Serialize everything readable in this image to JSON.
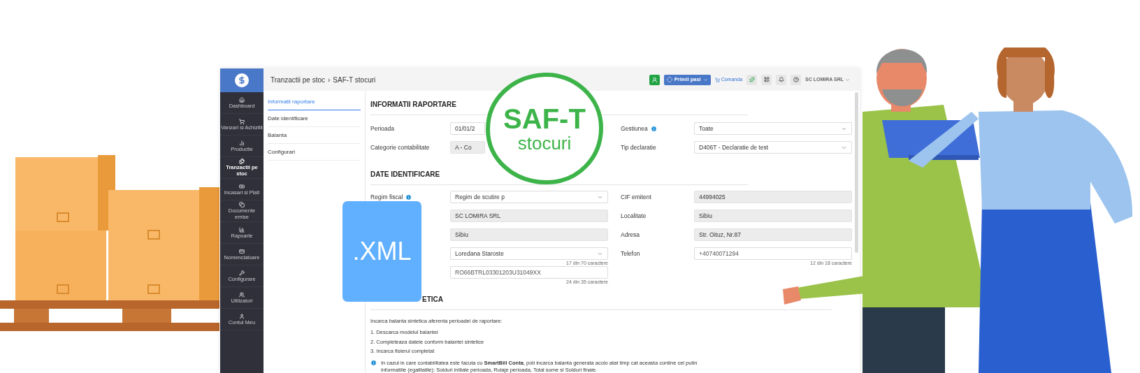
{
  "sidebar": {
    "items": [
      {
        "label": "Dashboard",
        "selected": false
      },
      {
        "label": "Vanzari si Achizitii",
        "selected": false
      },
      {
        "label": "Productie",
        "selected": false
      },
      {
        "label": "Tranzactii pe stoc",
        "selected": true
      },
      {
        "label": "Incasari si Plati",
        "selected": false
      },
      {
        "label": "Documente emise",
        "selected": false
      },
      {
        "label": "Rapoarte",
        "selected": false
      },
      {
        "label": "Nomenclatoare",
        "selected": false
      },
      {
        "label": "Configurare",
        "selected": false
      },
      {
        "label": "Utilizatori",
        "selected": false
      },
      {
        "label": "Contul Meu",
        "selected": false
      }
    ]
  },
  "breadcrumb": {
    "items": [
      "Tranzactii pe stoc",
      "SAF-T stocuri"
    ],
    "separator": "›"
  },
  "toolbar": {
    "primary_button": "Primii pasi",
    "order_link": "Comanda",
    "company": "SC LOMIRA SRL"
  },
  "subnav": [
    {
      "label": "Informatii raportare",
      "selected": true
    },
    {
      "label": "Date identificare",
      "selected": false
    },
    {
      "label": "Balanta",
      "selected": false
    },
    {
      "label": "Configurari",
      "selected": false
    }
  ],
  "sections": [
    {
      "heading": "INFORMATII RAPORTARE",
      "rows": [
        {
          "left": {
            "label": "Perioada",
            "kind": "date",
            "value": "01/01/2"
          },
          "right": {
            "label": "Gestiunea",
            "info": true,
            "kind": "select",
            "value": "Toate"
          }
        },
        {
          "left": {
            "label": "Categorie contabilitate",
            "kind": "locked_select",
            "value": "A - Co"
          },
          "right": {
            "label": "Tip declaratie",
            "kind": "select",
            "value": "D406T - Declaratie de test"
          }
        }
      ]
    },
    {
      "heading": "DATE IDENTIFICARE",
      "rows": [
        {
          "left": {
            "label": "Regim fiscal",
            "info": true,
            "kind": "select",
            "value": "Regim de scutire p"
          },
          "right": {
            "label": "CIF emitent",
            "kind": "readonly",
            "value": "44994025"
          }
        },
        {
          "left": {
            "kind": "readonly",
            "value": "SC LOMIRA SRL"
          },
          "right": {
            "label": "Localitate",
            "kind": "readonly",
            "value": "Sibiu"
          }
        },
        {
          "left": {
            "kind": "readonly",
            "value": "Sibiu"
          },
          "right": {
            "label": "Adresa",
            "kind": "readonly",
            "value": "Str. Oituz, Nr.87"
          }
        },
        {
          "left": {
            "kind": "select",
            "value": "Loredana Staroste",
            "counter": "17 din 70 caractere"
          },
          "right": {
            "label": "Telefon",
            "kind": "text",
            "value": "+40740071294",
            "counter": "12 din 18 caractere"
          }
        },
        {
          "left": {
            "kind": "text",
            "value": "RO66BTRL03301203U31049XX",
            "counter": "24 din 35 caractere"
          }
        }
      ]
    }
  ],
  "balance": {
    "heading": "ETICA",
    "intro": "Incarca balanta sintetica aferenta perioadei de raportare:",
    "steps": [
      "1. Descarca modelul balantei",
      "2. Completeaza datele conform balantei sintetice",
      "3. Incarca fisierul completat"
    ],
    "note": "In cazul in care contabilitatea este facuta cu **SmartBill Conta**, poti incarca balanta generata acolo atat timp cat aceasta contine cel putin informatiile (egalitatile): Solduri initiale perioada, Rulaje perioada, Total sume si Solduri finale."
  },
  "badge": {
    "title": "SAF-T",
    "subtitle": "stocuri"
  },
  "file_card": {
    "label": ".XML"
  }
}
